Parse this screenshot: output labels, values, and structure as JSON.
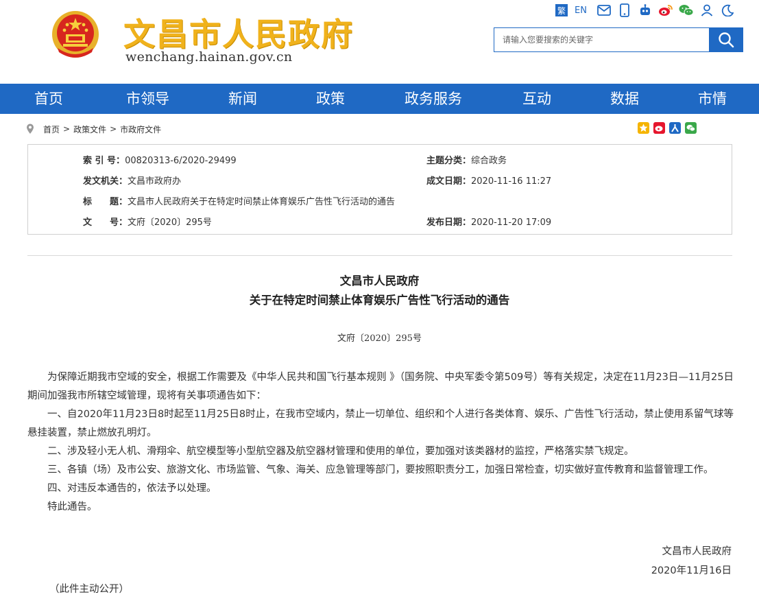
{
  "header": {
    "site_title": "文昌市人民政府",
    "site_domain": "wenchang.hainan.gov.cn",
    "lang_trad": "繁",
    "lang_en": "EN",
    "search_placeholder": "请输入您要搜索的关键字"
  },
  "nav": [
    "首页",
    "市领导",
    "新闻",
    "政策",
    "政务服务",
    "互动",
    "数据",
    "市情"
  ],
  "breadcrumb": [
    "首页",
    "政策文件",
    "市政府文件"
  ],
  "meta": {
    "index_label": "索 引 号：",
    "index_value": "00820313-6/2020-29499",
    "category_label": "主题分类：",
    "category_value": "综合政务",
    "issuer_label": "发文机关：",
    "issuer_value": "文昌市政府办",
    "created_label": "成文日期：",
    "created_value": "2020-11-16 11:27",
    "title_label": "标　　题：",
    "title_value": "文昌市人民政府关于在特定时间禁止体育娱乐广告性飞行活动的通告",
    "docno_label": "文　　号：",
    "docno_value": "文府〔2020〕295号",
    "published_label": "发布日期：",
    "published_value": "2020-11-20 17:09"
  },
  "document": {
    "title_line1": "文昌市人民政府",
    "title_line2": "关于在特定时间禁止体育娱乐广告性飞行活动的通告",
    "doc_no": "文府〔2020〕295号",
    "paragraphs": [
      "为保障近期我市空域的安全，根据工作需要及《中华人民共和国飞行基本规则 》（国务院、中央军委令第509号）等有关规定，决定在11月23日—11月25日期间加强我市所辖空域管理，现将有关事项通告如下：",
      "一、自2020年11月23日8时起至11月25日8时止，在我市空域内，禁止一切单位、组织和个人进行各类体育、娱乐、广告性飞行活动，禁止使用系留气球等悬挂装置，禁止燃放孔明灯。",
      "二、涉及轻小无人机、滑翔伞、航空模型等小型航空器及航空器材管理和使用的单位，要加强对该类器材的监控，严格落实禁飞规定。",
      "三、各镇（场）及市公安、旅游文化、市场监管、气象、海关、应急管理等部门，要按照职责分工，加强日常检查，切实做好宣传教育和监督管理工作。",
      "四、对违反本通告的，依法予以处理。",
      "特此通告。"
    ],
    "signer": "文昌市人民政府",
    "sign_date": "2020年11月16日",
    "note": "（此件主动公开）"
  },
  "colors": {
    "brand_blue": "#1f69c4",
    "title_gold": "#f0b21c"
  }
}
